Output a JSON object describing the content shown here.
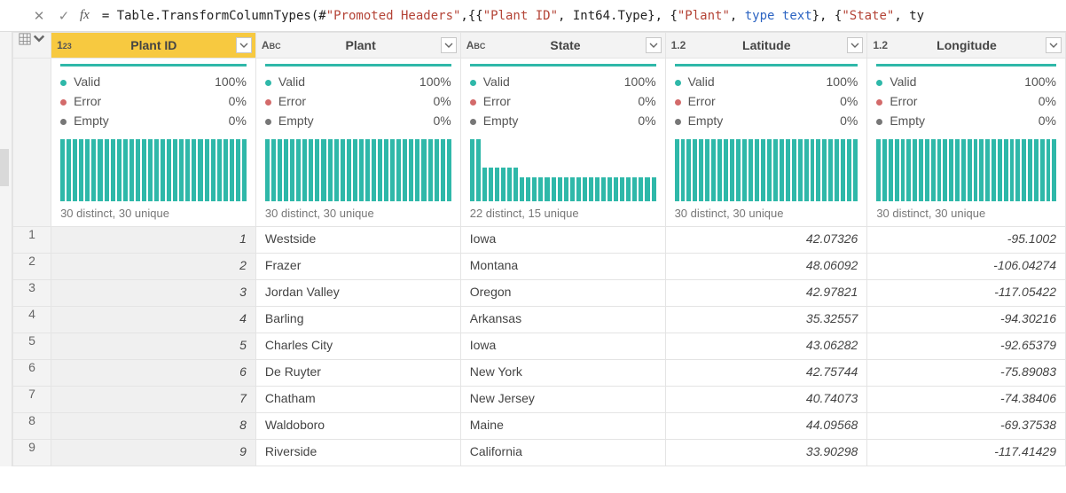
{
  "formula_bar": {
    "cancel_glyph": "✕",
    "confirm_glyph": "✓",
    "fx_label": "fx",
    "tokens": [
      {
        "t": "plain",
        "v": "= "
      },
      {
        "t": "fn",
        "v": "Table.TransformColumnTypes"
      },
      {
        "t": "plain",
        "v": "(#"
      },
      {
        "t": "str",
        "v": "\"Promoted Headers\""
      },
      {
        "t": "plain",
        "v": ",{{"
      },
      {
        "t": "str",
        "v": "\"Plant ID\""
      },
      {
        "t": "plain",
        "v": ", Int64.Type}, {"
      },
      {
        "t": "str",
        "v": "\"Plant\""
      },
      {
        "t": "plain",
        "v": ", "
      },
      {
        "t": "kw",
        "v": "type"
      },
      {
        "t": "plain",
        "v": " "
      },
      {
        "t": "type",
        "v": "text"
      },
      {
        "t": "plain",
        "v": "}, {"
      },
      {
        "t": "str",
        "v": "\"State\""
      },
      {
        "t": "plain",
        "v": ", ty"
      }
    ]
  },
  "columns": [
    {
      "key": "plant_id",
      "type_label": "123",
      "name": "Plant ID",
      "selected": true,
      "stats": {
        "valid": "100%",
        "error": "0%",
        "empty": "0%"
      },
      "dist_summary": "30 distinct, 30 unique",
      "bars": [
        100,
        100,
        100,
        100,
        100,
        100,
        100,
        100,
        100,
        100,
        100,
        100,
        100,
        100,
        100,
        100,
        100,
        100,
        100,
        100,
        100,
        100,
        100,
        100,
        100,
        100,
        100,
        100,
        100,
        100
      ]
    },
    {
      "key": "plant",
      "type_label": "ABC",
      "name": "Plant",
      "selected": false,
      "stats": {
        "valid": "100%",
        "error": "0%",
        "empty": "0%"
      },
      "dist_summary": "30 distinct, 30 unique",
      "bars": [
        100,
        100,
        100,
        100,
        100,
        100,
        100,
        100,
        100,
        100,
        100,
        100,
        100,
        100,
        100,
        100,
        100,
        100,
        100,
        100,
        100,
        100,
        100,
        100,
        100,
        100,
        100,
        100,
        100,
        100
      ]
    },
    {
      "key": "state",
      "type_label": "ABC",
      "name": "State",
      "selected": false,
      "stats": {
        "valid": "100%",
        "error": "0%",
        "empty": "0%"
      },
      "dist_summary": "22 distinct, 15 unique",
      "bars": [
        100,
        100,
        55,
        55,
        55,
        55,
        55,
        55,
        38,
        38,
        38,
        38,
        38,
        38,
        38,
        38,
        38,
        38,
        38,
        38,
        38,
        38,
        38,
        38,
        38,
        38,
        38,
        38,
        38,
        38
      ]
    },
    {
      "key": "latitude",
      "type_label": "1.2",
      "name": "Latitude",
      "selected": false,
      "stats": {
        "valid": "100%",
        "error": "0%",
        "empty": "0%"
      },
      "dist_summary": "30 distinct, 30 unique",
      "bars": [
        100,
        100,
        100,
        100,
        100,
        100,
        100,
        100,
        100,
        100,
        100,
        100,
        100,
        100,
        100,
        100,
        100,
        100,
        100,
        100,
        100,
        100,
        100,
        100,
        100,
        100,
        100,
        100,
        100,
        100
      ]
    },
    {
      "key": "longitude",
      "type_label": "1.2",
      "name": "Longitude",
      "selected": false,
      "stats": {
        "valid": "100%",
        "error": "0%",
        "empty": "0%"
      },
      "dist_summary": "30 distinct, 30 unique",
      "bars": [
        100,
        100,
        100,
        100,
        100,
        100,
        100,
        100,
        100,
        100,
        100,
        100,
        100,
        100,
        100,
        100,
        100,
        100,
        100,
        100,
        100,
        100,
        100,
        100,
        100,
        100,
        100,
        100,
        100,
        100
      ]
    }
  ],
  "stat_labels": {
    "valid": "Valid",
    "error": "Error",
    "empty": "Empty"
  },
  "rows": [
    {
      "n": "1",
      "plant_id": "1",
      "plant": "Westside",
      "state": "Iowa",
      "latitude": "42.07326",
      "longitude": "-95.1002"
    },
    {
      "n": "2",
      "plant_id": "2",
      "plant": "Frazer",
      "state": "Montana",
      "latitude": "48.06092",
      "longitude": "-106.04274"
    },
    {
      "n": "3",
      "plant_id": "3",
      "plant": "Jordan Valley",
      "state": "Oregon",
      "latitude": "42.97821",
      "longitude": "-117.05422"
    },
    {
      "n": "4",
      "plant_id": "4",
      "plant": "Barling",
      "state": "Arkansas",
      "latitude": "35.32557",
      "longitude": "-94.30216"
    },
    {
      "n": "5",
      "plant_id": "5",
      "plant": "Charles City",
      "state": "Iowa",
      "latitude": "43.06282",
      "longitude": "-92.65379"
    },
    {
      "n": "6",
      "plant_id": "6",
      "plant": "De Ruyter",
      "state": "New York",
      "latitude": "42.75744",
      "longitude": "-75.89083"
    },
    {
      "n": "7",
      "plant_id": "7",
      "plant": "Chatham",
      "state": "New Jersey",
      "latitude": "40.74073",
      "longitude": "-74.38406"
    },
    {
      "n": "8",
      "plant_id": "8",
      "plant": "Waldoboro",
      "state": "Maine",
      "latitude": "44.09568",
      "longitude": "-69.37538"
    },
    {
      "n": "9",
      "plant_id": "9",
      "plant": "Riverside",
      "state": "California",
      "latitude": "33.90298",
      "longitude": "-117.41429"
    }
  ],
  "chart_data": [
    {
      "type": "bar",
      "title": "Plant ID distribution",
      "categories_count": 30,
      "values": [
        1,
        1,
        1,
        1,
        1,
        1,
        1,
        1,
        1,
        1,
        1,
        1,
        1,
        1,
        1,
        1,
        1,
        1,
        1,
        1,
        1,
        1,
        1,
        1,
        1,
        1,
        1,
        1,
        1,
        1
      ],
      "ylim": [
        0,
        1
      ]
    },
    {
      "type": "bar",
      "title": "Plant distribution",
      "categories_count": 30,
      "values": [
        1,
        1,
        1,
        1,
        1,
        1,
        1,
        1,
        1,
        1,
        1,
        1,
        1,
        1,
        1,
        1,
        1,
        1,
        1,
        1,
        1,
        1,
        1,
        1,
        1,
        1,
        1,
        1,
        1,
        1
      ],
      "ylim": [
        0,
        1
      ]
    },
    {
      "type": "bar",
      "title": "State distribution",
      "categories_count": 30,
      "values": [
        3,
        3,
        2,
        2,
        2,
        2,
        2,
        2,
        1,
        1,
        1,
        1,
        1,
        1,
        1,
        1,
        1,
        1,
        1,
        1,
        1,
        1,
        1,
        1,
        1,
        1,
        1,
        1,
        1,
        1
      ],
      "ylim": [
        0,
        3
      ]
    },
    {
      "type": "bar",
      "title": "Latitude distribution",
      "categories_count": 30,
      "values": [
        1,
        1,
        1,
        1,
        1,
        1,
        1,
        1,
        1,
        1,
        1,
        1,
        1,
        1,
        1,
        1,
        1,
        1,
        1,
        1,
        1,
        1,
        1,
        1,
        1,
        1,
        1,
        1,
        1,
        1
      ],
      "ylim": [
        0,
        1
      ]
    },
    {
      "type": "bar",
      "title": "Longitude distribution",
      "categories_count": 30,
      "values": [
        1,
        1,
        1,
        1,
        1,
        1,
        1,
        1,
        1,
        1,
        1,
        1,
        1,
        1,
        1,
        1,
        1,
        1,
        1,
        1,
        1,
        1,
        1,
        1,
        1,
        1,
        1,
        1,
        1,
        1
      ],
      "ylim": [
        0,
        1
      ]
    }
  ]
}
